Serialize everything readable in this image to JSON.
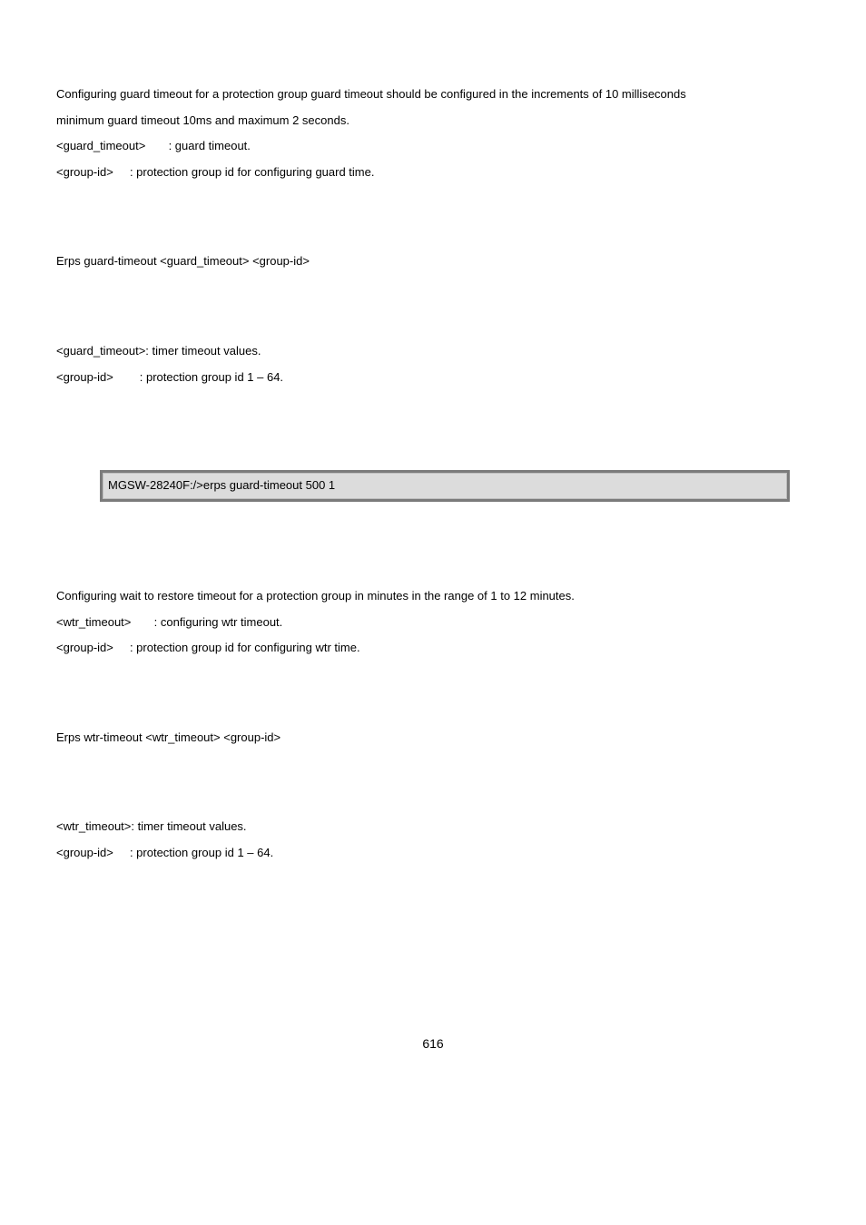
{
  "sec1": {
    "desc_line1": "Configuring guard timeout for a protection group guard timeout should be configured in the increments of 10 milliseconds",
    "desc_line2": "minimum guard timeout 10ms and maximum 2 seconds.",
    "param1": "<guard_timeout>       : guard timeout.",
    "param2": "<group-id>     : protection group id for configuring guard time.",
    "syntax": "Erps guard-timeout <guard_timeout> <group-id>",
    "p1": "<guard_timeout>: timer timeout values.",
    "p2": "<group-id>        : protection group id 1 – 64.",
    "example": "MGSW-28240F:/>erps guard-timeout 500 1"
  },
  "sec2": {
    "desc_line1": "Configuring wait to restore timeout for a protection group in minutes in the range of 1 to 12 minutes.",
    "param1": "<wtr_timeout>       : configuring wtr timeout.",
    "param2": "<group-id>     : protection group id for configuring wtr time.",
    "syntax": "Erps wtr-timeout <wtr_timeout> <group-id>",
    "p1": "<wtr_timeout>: timer timeout values.",
    "p2": "<group-id>     : protection group id 1 – 64."
  },
  "page_number": "616"
}
